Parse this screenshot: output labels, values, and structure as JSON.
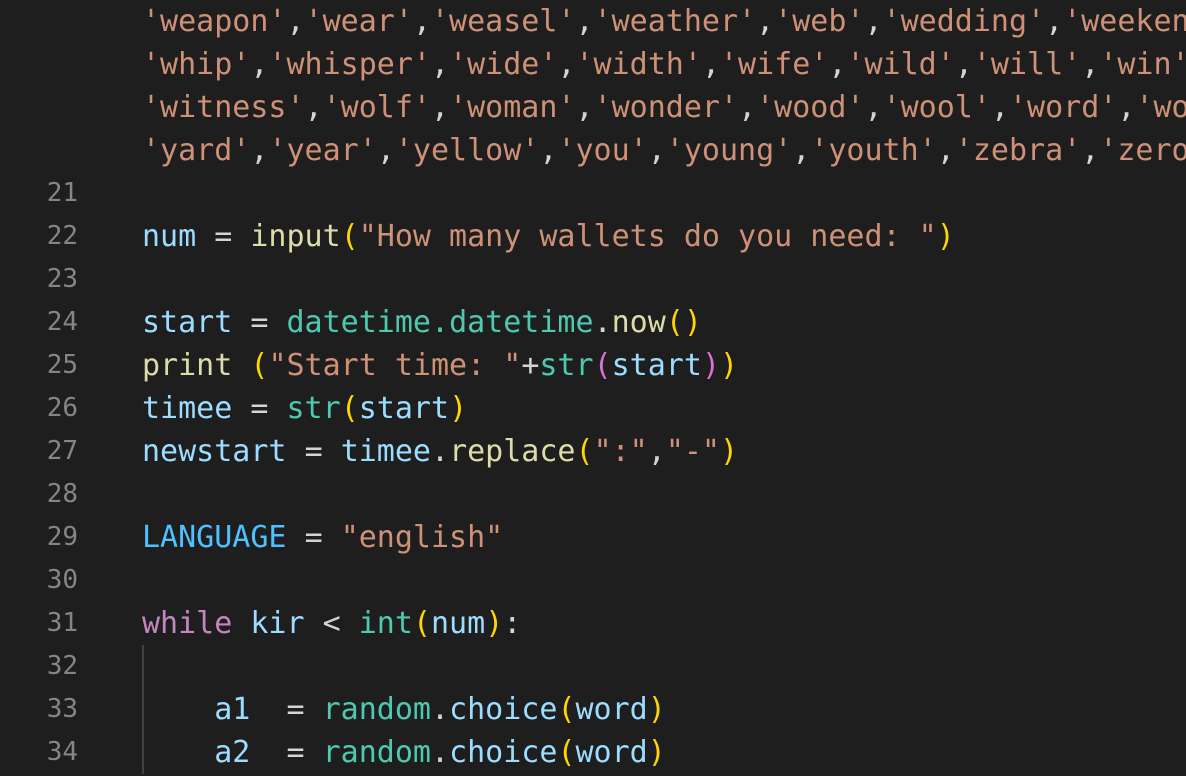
{
  "editor": {
    "language": "python",
    "background": "#1e1e1e",
    "gutter_color": "#858585",
    "indent_guide_color": "#404040",
    "font_size_px": 30,
    "line_height_px": 43,
    "first_visible_line_number": 21,
    "last_visible_line_number": 34
  },
  "colors": {
    "string": "#ce9178",
    "variable": "#9cdcfe",
    "constant": "#4fc1ff",
    "function": "#dcdcaa",
    "class": "#4ec9b0",
    "keyword": "#c586c0",
    "operator": "#d4d4d4",
    "bracket_level_1": "#ffd700",
    "bracket_level_2": "#da70d6",
    "bracket_level_3": "#179fff"
  },
  "wrapped_list_rows": [
    {
      "id": "wrap-row-1",
      "tokens": [
        {
          "t": "'weapon'",
          "c": "str"
        },
        {
          "t": ",",
          "c": "punct"
        },
        {
          "t": "'wear'",
          "c": "str"
        },
        {
          "t": ",",
          "c": "punct"
        },
        {
          "t": "'weasel'",
          "c": "str"
        },
        {
          "t": ",",
          "c": "punct"
        },
        {
          "t": "'weather'",
          "c": "str"
        },
        {
          "t": ",",
          "c": "punct"
        },
        {
          "t": "'web'",
          "c": "str"
        },
        {
          "t": ",",
          "c": "punct"
        },
        {
          "t": "'wedding'",
          "c": "str"
        },
        {
          "t": ",",
          "c": "punct"
        },
        {
          "t": "'weekend'",
          "c": "str"
        }
      ]
    },
    {
      "id": "wrap-row-2",
      "tokens": [
        {
          "t": "'whip'",
          "c": "str"
        },
        {
          "t": ",",
          "c": "punct"
        },
        {
          "t": "'whisper'",
          "c": "str"
        },
        {
          "t": ",",
          "c": "punct"
        },
        {
          "t": "'wide'",
          "c": "str"
        },
        {
          "t": ",",
          "c": "punct"
        },
        {
          "t": "'width'",
          "c": "str"
        },
        {
          "t": ",",
          "c": "punct"
        },
        {
          "t": "'wife'",
          "c": "str"
        },
        {
          "t": ",",
          "c": "punct"
        },
        {
          "t": "'wild'",
          "c": "str"
        },
        {
          "t": ",",
          "c": "punct"
        },
        {
          "t": "'will'",
          "c": "str"
        },
        {
          "t": ",",
          "c": "punct"
        },
        {
          "t": "'win'",
          "c": "str"
        },
        {
          "t": ",",
          "c": "punct"
        },
        {
          "t": "'",
          "c": "str"
        }
      ]
    },
    {
      "id": "wrap-row-3",
      "tokens": [
        {
          "t": "'witness'",
          "c": "str"
        },
        {
          "t": ",",
          "c": "punct"
        },
        {
          "t": "'wolf'",
          "c": "str"
        },
        {
          "t": ",",
          "c": "punct"
        },
        {
          "t": "'woman'",
          "c": "str"
        },
        {
          "t": ",",
          "c": "punct"
        },
        {
          "t": "'wonder'",
          "c": "str"
        },
        {
          "t": ",",
          "c": "punct"
        },
        {
          "t": "'wood'",
          "c": "str"
        },
        {
          "t": ",",
          "c": "punct"
        },
        {
          "t": "'wool'",
          "c": "str"
        },
        {
          "t": ",",
          "c": "punct"
        },
        {
          "t": "'word'",
          "c": "str"
        },
        {
          "t": ",",
          "c": "punct"
        },
        {
          "t": "'work",
          "c": "str"
        }
      ]
    },
    {
      "id": "wrap-row-4",
      "tokens": [
        {
          "t": "'yard'",
          "c": "str"
        },
        {
          "t": ",",
          "c": "punct"
        },
        {
          "t": "'year'",
          "c": "str"
        },
        {
          "t": ",",
          "c": "punct"
        },
        {
          "t": "'yellow'",
          "c": "str"
        },
        {
          "t": ",",
          "c": "punct"
        },
        {
          "t": "'you'",
          "c": "str"
        },
        {
          "t": ",",
          "c": "punct"
        },
        {
          "t": "'young'",
          "c": "str"
        },
        {
          "t": ",",
          "c": "punct"
        },
        {
          "t": "'youth'",
          "c": "str"
        },
        {
          "t": ",",
          "c": "punct"
        },
        {
          "t": "'zebra'",
          "c": "str"
        },
        {
          "t": ",",
          "c": "punct"
        },
        {
          "t": "'zero'",
          "c": "str"
        },
        {
          "t": ",",
          "c": "punct"
        }
      ]
    }
  ],
  "lines": [
    {
      "number": "21",
      "text": "",
      "tokens": []
    },
    {
      "number": "22",
      "text": "num = input(\"How many wallets do you need: \")",
      "tokens": [
        {
          "t": "num",
          "c": "var"
        },
        {
          "t": " ",
          "c": "op"
        },
        {
          "t": "=",
          "c": "op"
        },
        {
          "t": " ",
          "c": "op"
        },
        {
          "t": "input",
          "c": "func"
        },
        {
          "t": "(",
          "c": "br1"
        },
        {
          "t": "\"How many wallets do you need: \"",
          "c": "str"
        },
        {
          "t": ")",
          "c": "br1"
        }
      ]
    },
    {
      "number": "23",
      "text": "",
      "tokens": []
    },
    {
      "number": "24",
      "text": "start = datetime.datetime.now()",
      "tokens": [
        {
          "t": "start",
          "c": "var"
        },
        {
          "t": " ",
          "c": "op"
        },
        {
          "t": "=",
          "c": "op"
        },
        {
          "t": " ",
          "c": "op"
        },
        {
          "t": "datetime",
          "c": "class"
        },
        {
          "t": ".",
          "c": "class"
        },
        {
          "t": "datetime",
          "c": "class"
        },
        {
          "t": ".",
          "c": "op"
        },
        {
          "t": "now",
          "c": "func"
        },
        {
          "t": "(",
          "c": "br1"
        },
        {
          "t": ")",
          "c": "br1"
        }
      ]
    },
    {
      "number": "25",
      "text": "print (\"Start time: \"+str(start))",
      "tokens": [
        {
          "t": "print",
          "c": "func"
        },
        {
          "t": " ",
          "c": "op"
        },
        {
          "t": "(",
          "c": "br1"
        },
        {
          "t": "\"Start time: \"",
          "c": "str"
        },
        {
          "t": "+",
          "c": "op"
        },
        {
          "t": "str",
          "c": "class"
        },
        {
          "t": "(",
          "c": "br2"
        },
        {
          "t": "start",
          "c": "var"
        },
        {
          "t": ")",
          "c": "br2"
        },
        {
          "t": ")",
          "c": "br1"
        }
      ]
    },
    {
      "number": "26",
      "text": "timee = str(start)",
      "tokens": [
        {
          "t": "timee",
          "c": "var"
        },
        {
          "t": " ",
          "c": "op"
        },
        {
          "t": "=",
          "c": "op"
        },
        {
          "t": " ",
          "c": "op"
        },
        {
          "t": "str",
          "c": "class"
        },
        {
          "t": "(",
          "c": "br1"
        },
        {
          "t": "start",
          "c": "var"
        },
        {
          "t": ")",
          "c": "br1"
        }
      ]
    },
    {
      "number": "27",
      "text": "newstart = timee.replace(\":\",\"-\")",
      "tokens": [
        {
          "t": "newstart",
          "c": "var"
        },
        {
          "t": " ",
          "c": "op"
        },
        {
          "t": "=",
          "c": "op"
        },
        {
          "t": " ",
          "c": "op"
        },
        {
          "t": "timee",
          "c": "var"
        },
        {
          "t": ".",
          "c": "op"
        },
        {
          "t": "replace",
          "c": "func"
        },
        {
          "t": "(",
          "c": "br1"
        },
        {
          "t": "\":\"",
          "c": "str"
        },
        {
          "t": ",",
          "c": "punct"
        },
        {
          "t": "\"-\"",
          "c": "str"
        },
        {
          "t": ")",
          "c": "br1"
        }
      ]
    },
    {
      "number": "28",
      "text": "",
      "tokens": []
    },
    {
      "number": "29",
      "text": "LANGUAGE = \"english\"",
      "tokens": [
        {
          "t": "LANGUAGE",
          "c": "const"
        },
        {
          "t": " ",
          "c": "op"
        },
        {
          "t": "=",
          "c": "op"
        },
        {
          "t": " ",
          "c": "op"
        },
        {
          "t": "\"english\"",
          "c": "str"
        }
      ]
    },
    {
      "number": "30",
      "text": "",
      "tokens": []
    },
    {
      "number": "31",
      "text": "while kir < int(num):",
      "tokens": [
        {
          "t": "while",
          "c": "kw"
        },
        {
          "t": " ",
          "c": "op"
        },
        {
          "t": "kir",
          "c": "var"
        },
        {
          "t": " ",
          "c": "op"
        },
        {
          "t": "<",
          "c": "op"
        },
        {
          "t": " ",
          "c": "op"
        },
        {
          "t": "int",
          "c": "class"
        },
        {
          "t": "(",
          "c": "br1"
        },
        {
          "t": "num",
          "c": "var"
        },
        {
          "t": ")",
          "c": "br1"
        },
        {
          "t": ":",
          "c": "op"
        }
      ]
    },
    {
      "number": "32",
      "text": "",
      "tokens": [],
      "indent_guide": true
    },
    {
      "number": "33",
      "text": "    a1  = random.choice(word)",
      "indent_guide": true,
      "tokens": [
        {
          "t": "    ",
          "c": "op"
        },
        {
          "t": "a1",
          "c": "var"
        },
        {
          "t": "  ",
          "c": "op"
        },
        {
          "t": "=",
          "c": "op"
        },
        {
          "t": " ",
          "c": "op"
        },
        {
          "t": "random",
          "c": "class"
        },
        {
          "t": ".",
          "c": "op"
        },
        {
          "t": "choice",
          "c": "var"
        },
        {
          "t": "(",
          "c": "br1"
        },
        {
          "t": "word",
          "c": "var"
        },
        {
          "t": ")",
          "c": "br1"
        }
      ]
    },
    {
      "number": "34",
      "text": "    a2  = random.choice(word)",
      "indent_guide": true,
      "tokens": [
        {
          "t": "    ",
          "c": "op"
        },
        {
          "t": "a2",
          "c": "var"
        },
        {
          "t": "  ",
          "c": "op"
        },
        {
          "t": "=",
          "c": "op"
        },
        {
          "t": " ",
          "c": "op"
        },
        {
          "t": "random",
          "c": "class"
        },
        {
          "t": ".",
          "c": "op"
        },
        {
          "t": "choice",
          "c": "var"
        },
        {
          "t": "(",
          "c": "br1"
        },
        {
          "t": "word",
          "c": "var"
        },
        {
          "t": ")",
          "c": "br1"
        }
      ]
    }
  ]
}
